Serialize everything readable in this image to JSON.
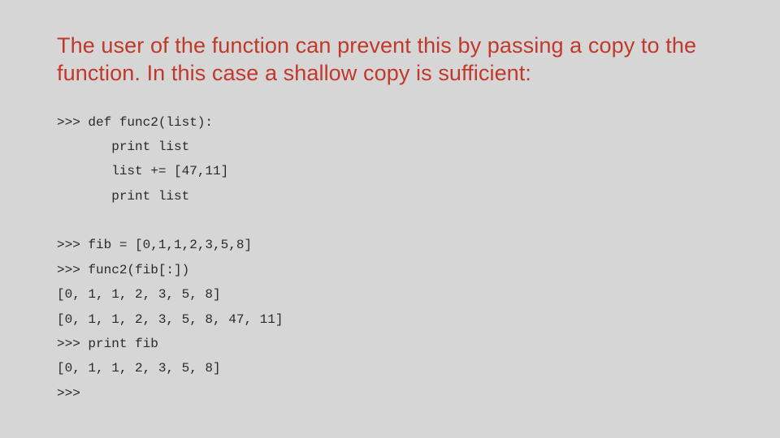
{
  "heading": "The user of the function can prevent this by passing a copy to the function. In this case a shallow copy is sufficient:",
  "code": {
    "l1": ">>> def func2(list):",
    "l2": "       print list",
    "l3": "       list += [47,11]",
    "l4": "       print list",
    "l5": "",
    "l6": ">>> fib = [0,1,1,2,3,5,8]",
    "l7": ">>> func2(fib[:])",
    "l8": "[0, 1, 1, 2, 3, 5, 8]",
    "l9": "[0, 1, 1, 2, 3, 5, 8, 47, 11]",
    "l10": ">>> print fib",
    "l11": "[0, 1, 1, 2, 3, 5, 8]",
    "l12": ">>>"
  }
}
